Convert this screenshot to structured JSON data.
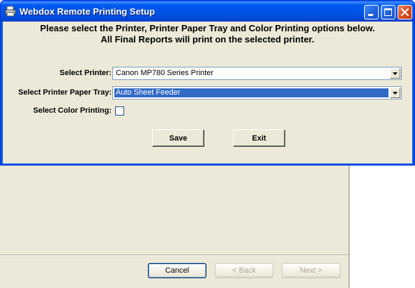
{
  "wizard": {
    "buttons": {
      "cancel": "Cancel",
      "back": "< Back",
      "next": "Next >"
    }
  },
  "window": {
    "title": "Webdox Remote Printing Setup",
    "heading_line1": "Please select the Printer, Printer Paper Tray and Color Printing options below.",
    "heading_line2": "All Final Reports will print on the selected printer.",
    "printer": {
      "label": "Select Printer:",
      "value": "Canon MP780 Series Printer"
    },
    "tray": {
      "label": "Select Printer Paper Tray:",
      "value": "Auto Sheet Feeder"
    },
    "color": {
      "label": "Select Color Printing:",
      "checked": false
    },
    "save_label": "Save",
    "exit_label": "Exit"
  },
  "colors": {
    "titlebar": "#0054e3",
    "dialog_bg": "#ece9d8",
    "selection": "#316ac5",
    "close_button": "#d6481c"
  }
}
